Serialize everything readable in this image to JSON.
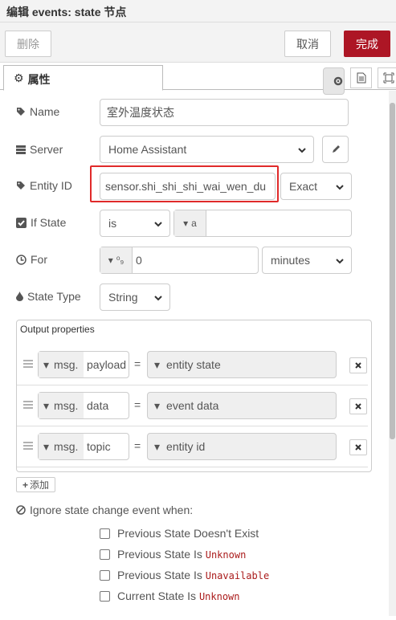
{
  "title": "编辑 events: state 节点",
  "toolbar": {
    "delete_label": "删除",
    "cancel_label": "取消",
    "done_label": "完成"
  },
  "tabs": {
    "properties_label": "属性"
  },
  "form": {
    "name_label": "Name",
    "name_value": "室外温度状态",
    "server_label": "Server",
    "server_value": "Home Assistant",
    "entity_label": "Entity ID",
    "entity_value": "sensor.shi_shi_shi_wai_wen_du",
    "entity_match": "Exact",
    "ifstate_label": "If State",
    "ifstate_op": "is",
    "ifstate_type_glyph": "a",
    "for_label": "For",
    "for_value": "0",
    "for_unit": "minutes",
    "statetype_label": "State Type",
    "statetype_value": "String"
  },
  "output": {
    "label": "Output properties",
    "rows": [
      {
        "prefix": "msg.",
        "property": "payload",
        "value": "entity state"
      },
      {
        "prefix": "msg.",
        "property": "data",
        "value": "event data"
      },
      {
        "prefix": "msg.",
        "property": "topic",
        "value": "entity id"
      }
    ],
    "add_label": "添加"
  },
  "ignore": {
    "heading": "Ignore state change event when:",
    "options": [
      {
        "text": "Previous State Doesn't Exist",
        "code": ""
      },
      {
        "text": "Previous State Is",
        "code": "Unknown"
      },
      {
        "text": "Previous State Is",
        "code": "Unavailable"
      },
      {
        "text": "Current State Is",
        "code": "Unknown"
      }
    ]
  },
  "colors": {
    "accent": "#ad1625",
    "highlight": "#e02a2a"
  }
}
